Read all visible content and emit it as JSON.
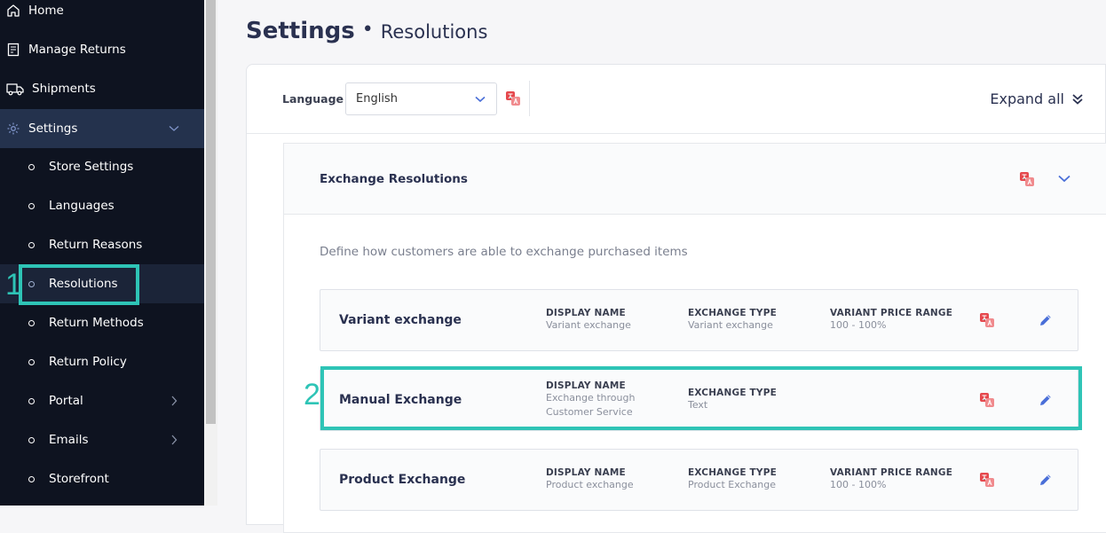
{
  "sidebar": {
    "main": [
      {
        "label": "Home",
        "icon": "home-icon"
      },
      {
        "label": "Manage Returns",
        "icon": "returns-icon"
      },
      {
        "label": "Shipments",
        "icon": "truck-icon"
      },
      {
        "label": "Settings",
        "icon": "gear-icon"
      }
    ],
    "sub": [
      {
        "label": "Store Settings"
      },
      {
        "label": "Languages"
      },
      {
        "label": "Return Reasons"
      },
      {
        "label": "Resolutions"
      },
      {
        "label": "Return Methods"
      },
      {
        "label": "Return Policy"
      },
      {
        "label": "Portal"
      },
      {
        "label": "Emails"
      },
      {
        "label": "Storefront"
      }
    ]
  },
  "annotations": {
    "one": "1",
    "two": "2"
  },
  "header": {
    "title": "Settings",
    "separator": "•",
    "subtitle": "Resolutions"
  },
  "toolbar": {
    "language_label": "Language",
    "language_value": "English",
    "expand_all": "Expand all"
  },
  "section": {
    "title": "Exchange Resolutions",
    "description": "Define how customers are able to exchange purchased items",
    "cards": [
      {
        "title": "Variant exchange",
        "display_name_label": "DISPLAY NAME",
        "display_name_value": "Variant exchange",
        "exchange_type_label": "EXCHANGE TYPE",
        "exchange_type_value": "Variant exchange",
        "price_range_label": "VARIANT PRICE RANGE",
        "price_range_value": "100 - 100%"
      },
      {
        "title": "Manual Exchange",
        "display_name_label": "DISPLAY NAME",
        "display_name_value_1": "Exchange through",
        "display_name_value_2": "Customer Service",
        "exchange_type_label": "EXCHANGE TYPE",
        "exchange_type_value": "Text"
      },
      {
        "title": "Product Exchange",
        "display_name_label": "DISPLAY NAME",
        "display_name_value": "Product exchange",
        "exchange_type_label": "EXCHANGE TYPE",
        "exchange_type_value": "Product Exchange",
        "price_range_label": "VARIANT PRICE RANGE",
        "price_range_value": "100 - 100%"
      }
    ]
  },
  "colors": {
    "sidebar_bg": "#0e1320",
    "active_bg": "#24324d",
    "accent": "#4a6fd8",
    "highlight": "#2ec4b6",
    "translate_red": "#e5484d",
    "title_text": "#2a3150"
  }
}
